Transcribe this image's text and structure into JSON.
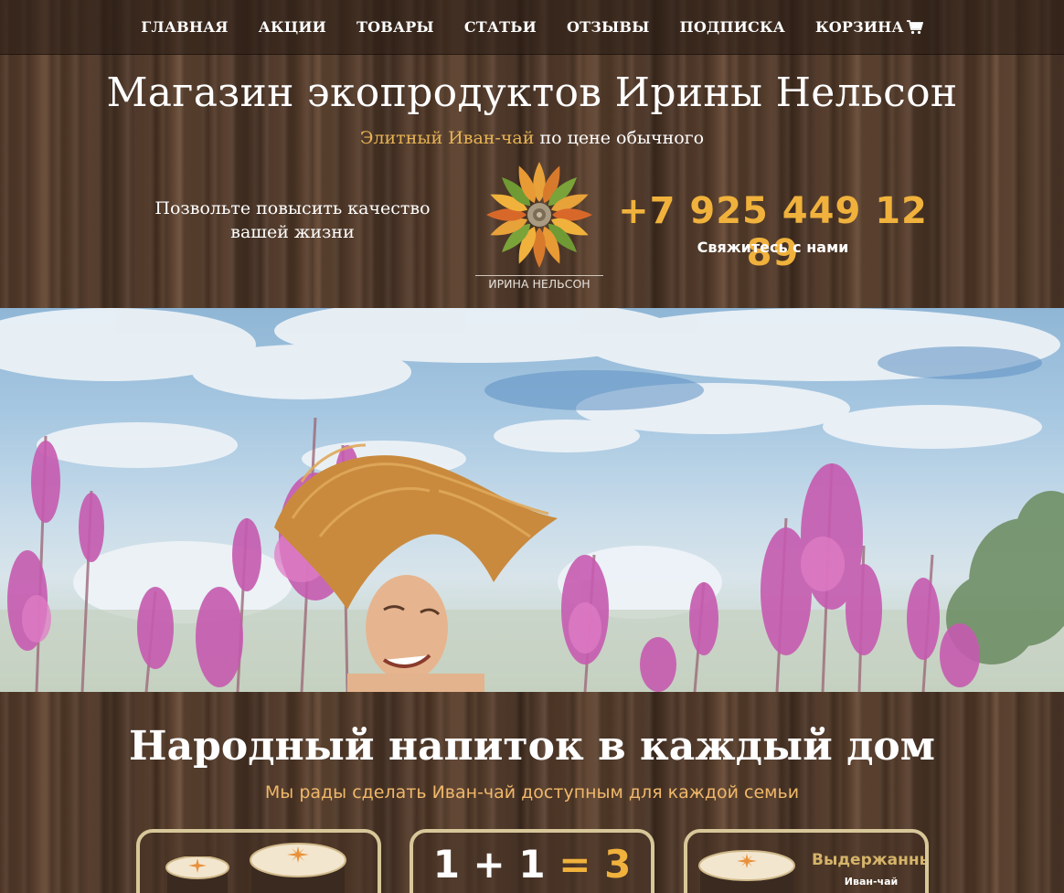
{
  "nav": {
    "items": [
      "ГЛАВНАЯ",
      "АКЦИИ",
      "ТОВАРЫ",
      "СТАТЬИ",
      "ОТЗЫВЫ",
      "ПОДПИСКА",
      "КОРЗИНА"
    ],
    "cart_icon": "shopping-cart-icon"
  },
  "header": {
    "title": "Магазин экопродуктов Ирины Нельсон",
    "subtitle_accent": "Элитный Иван-чай",
    "subtitle_rest": " по цене обычного",
    "slogan": "Позвольте повысить качество вашей жизни",
    "logo_text": "ИРИНА НЕЛЬСОН",
    "phone": "+7 925 449 12 89",
    "contact_label": "Свяжитесь с нами"
  },
  "section": {
    "title": "Народный напиток в каждый дом",
    "subtitle": "Мы рады сделать Иван-чай доступным для каждой семьи",
    "promo": {
      "eq_a": "1",
      "eq_plus": "+",
      "eq_b": "1",
      "eq_equals": "=",
      "eq_result": "3"
    },
    "aged_title": "Выдержанный",
    "aged_sub": "Иван-чай"
  },
  "colors": {
    "accent": "#f0b23c",
    "subtitle_accent": "#e8b354",
    "card_border": "#d7c799"
  }
}
